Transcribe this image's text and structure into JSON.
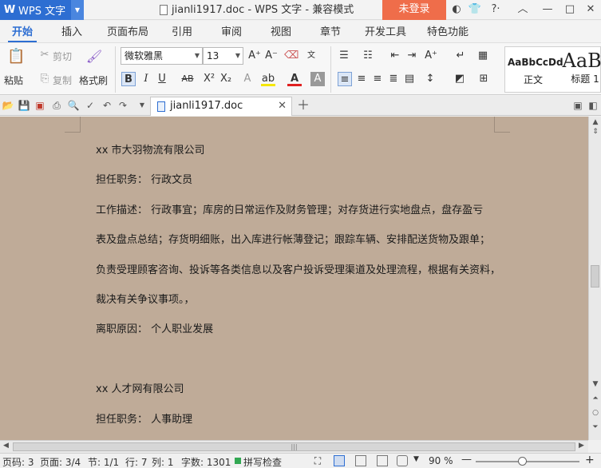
{
  "titlebar": {
    "app_name": "WPS 文字",
    "app_logo_letter": "W",
    "document_title": "jianli1917.doc - WPS 文字 - 兼容模式",
    "login_button": "未登录"
  },
  "ribbon_tabs": [
    "开始",
    "插入",
    "页面布局",
    "引用",
    "审阅",
    "视图",
    "章节",
    "开发工具",
    "特色功能"
  ],
  "ribbon": {
    "paste": "粘贴",
    "cut": "剪切",
    "copy": "复制",
    "format_painter": "格式刷",
    "font_name": "微软雅黑",
    "font_size": "13",
    "styles": [
      {
        "sample": "AaBbCcDd",
        "name": "正文"
      },
      {
        "sample": "AaBl",
        "name": "标题 1"
      }
    ]
  },
  "doc_tab": {
    "filename": "jianli1917.doc"
  },
  "document": {
    "lines": [
      "xx 市大羽物流有限公司",
      "担任职务： 行政文员",
      "工作描述： 行政事宜；库房的日常运作及财务管理；对存货进行实地盘点，盘存盈亏",
      "表及盘点总结；存货明细账，出入库进行帐薄登记；跟踪车辆、安排配送货物及跟单；",
      "负责受理顾客咨询、投诉等各类信息以及客户投诉受理渠道及处理流程，根据有关资料，",
      "裁决有关争议事项。，",
      "离职原因： 个人职业发展",
      "xx 人才网有限公司",
      "担任职务： 人事助理"
    ]
  },
  "statusbar": {
    "page_number": "页码: 3",
    "pages": "页面: 3/4",
    "section": "节: 1/1",
    "row": "行: 7",
    "column": "列: 1",
    "word_count": "字数: 1301",
    "spell_check": "拼写检查",
    "zoom": "90 %",
    "zoom_level": 0.9
  },
  "colors": {
    "accent": "#2d6ed2",
    "login": "#ef6d4a",
    "doc_background": "#bfab98"
  }
}
